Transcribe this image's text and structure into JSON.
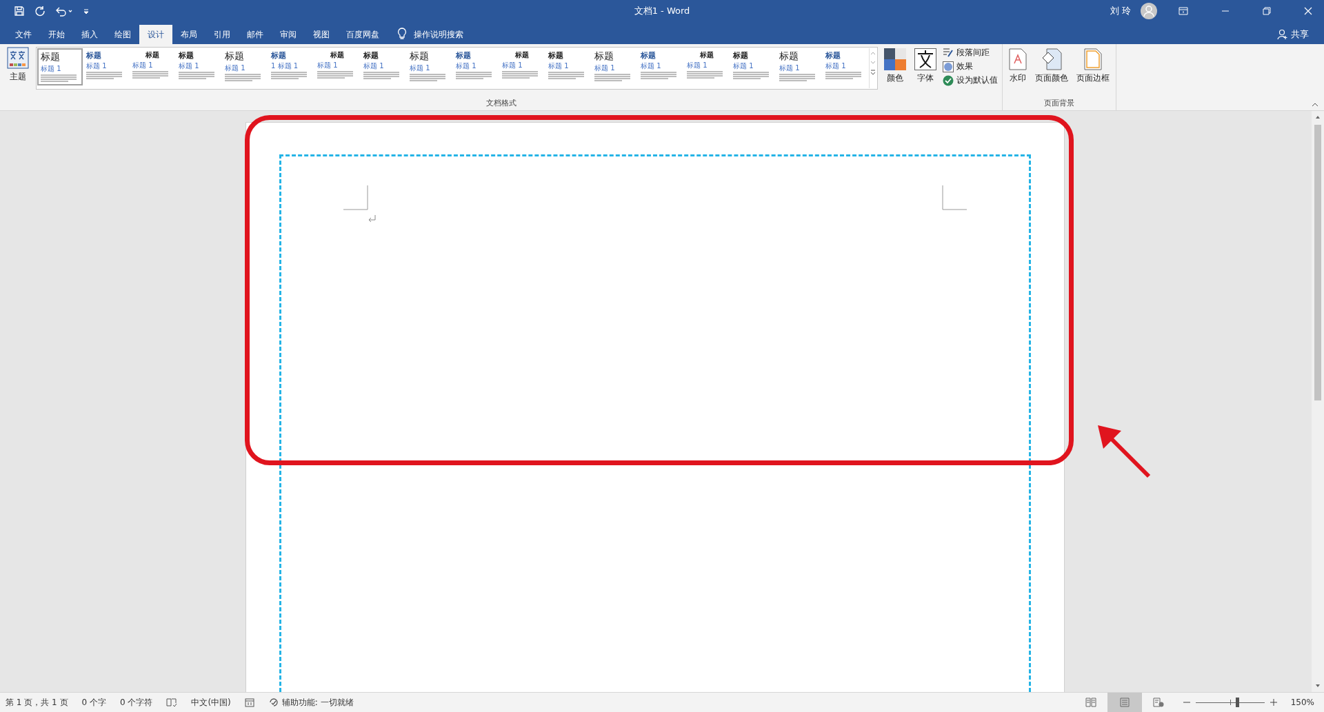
{
  "window": {
    "title": "文档1 - Word",
    "user": "刘 玲",
    "share": "共享"
  },
  "tabs": [
    {
      "label": "文件",
      "selected": false
    },
    {
      "label": "开始",
      "selected": false
    },
    {
      "label": "插入",
      "selected": false
    },
    {
      "label": "绘图",
      "selected": false
    },
    {
      "label": "设计",
      "selected": true
    },
    {
      "label": "布局",
      "selected": false
    },
    {
      "label": "引用",
      "selected": false
    },
    {
      "label": "邮件",
      "selected": false
    },
    {
      "label": "审阅",
      "selected": false
    },
    {
      "label": "视图",
      "selected": false
    },
    {
      "label": "百度网盘",
      "selected": false
    }
  ],
  "tell_me": "操作说明搜索",
  "ribbon": {
    "theme": "主题",
    "styles": [
      {
        "title": "标题",
        "sub": "标题 1",
        "selected": true
      },
      {
        "title": "标题",
        "sub": "标题 1",
        "selected": false
      },
      {
        "title": "标题",
        "sub": "标题 1",
        "selected": false
      },
      {
        "title": "标题",
        "sub": "标题 1",
        "selected": false
      },
      {
        "title": "标题",
        "sub": "标题 1",
        "selected": false
      },
      {
        "title": "标题",
        "sub": "1 标题 1",
        "selected": false
      },
      {
        "title": "标题",
        "sub": "标题 1",
        "selected": false
      },
      {
        "title": "标题",
        "sub": "标题 1",
        "selected": false
      },
      {
        "title": "标题",
        "sub": "标题 1",
        "selected": false
      },
      {
        "title": "标题",
        "sub": "标题 1",
        "selected": false
      },
      {
        "title": "标题",
        "sub": "标题 1",
        "selected": false
      },
      {
        "title": "标题",
        "sub": "标题 1",
        "selected": false
      },
      {
        "title": "标题",
        "sub": "标题 1",
        "selected": false
      },
      {
        "title": "标题",
        "sub": "标题 1",
        "selected": false
      },
      {
        "title": "标题",
        "sub": "标题 1",
        "selected": false
      },
      {
        "title": "标题",
        "sub": "标题 1",
        "selected": false
      },
      {
        "title": "标题",
        "sub": "标题 1",
        "selected": false
      },
      {
        "title": "标题",
        "sub": "标题 1",
        "selected": false
      }
    ],
    "colors": "颜色",
    "fonts": "字体",
    "paragraph_spacing": "段落间距",
    "effects": "效果",
    "set_default": "设为默认值",
    "group_format": "文档格式",
    "watermark": "水印",
    "page_color": "页面颜色",
    "page_borders": "页面边框",
    "group_background": "页面背景"
  },
  "status_bar": {
    "page": "第 1 页，共 1 页",
    "words": "0 个字",
    "chars": "0 个字符",
    "language": "中文(中国)",
    "accessibility": "辅助功能: 一切就绪",
    "zoom": "150%",
    "zoom_slider": {
      "level": 0.6
    }
  }
}
